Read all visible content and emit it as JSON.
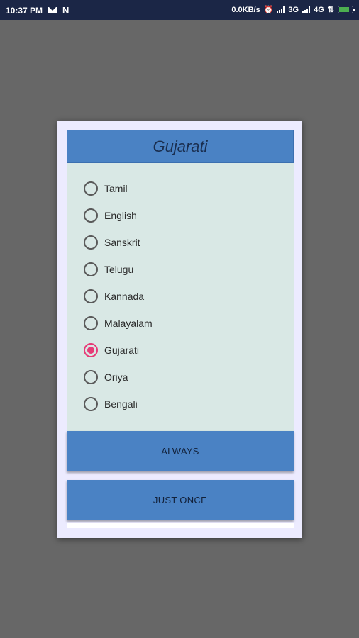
{
  "status_bar": {
    "time": "10:37 PM",
    "network_speed": "0.0KB/s",
    "sim1": "3G",
    "sim2": "4G",
    "icons": [
      "mail-icon",
      "n-notification-icon",
      "alarm-icon",
      "signal-icon",
      "battery-icon"
    ]
  },
  "dialog": {
    "title": "Gujarati",
    "options": [
      {
        "label": "Tamil",
        "selected": false
      },
      {
        "label": "English",
        "selected": false
      },
      {
        "label": "Sanskrit",
        "selected": false
      },
      {
        "label": "Telugu",
        "selected": false
      },
      {
        "label": "Kannada",
        "selected": false
      },
      {
        "label": "Malayalam",
        "selected": false
      },
      {
        "label": "Gujarati",
        "selected": true
      },
      {
        "label": "Oriya",
        "selected": false
      },
      {
        "label": "Bengali",
        "selected": false
      }
    ],
    "buttons": {
      "always": "ALWAYS",
      "just_once": "JUST ONCE"
    }
  },
  "colors": {
    "accent": "#4a82c4",
    "selected_radio": "#e73b77",
    "panel": "#d9e8e5",
    "status_bar": "#1b2646"
  }
}
